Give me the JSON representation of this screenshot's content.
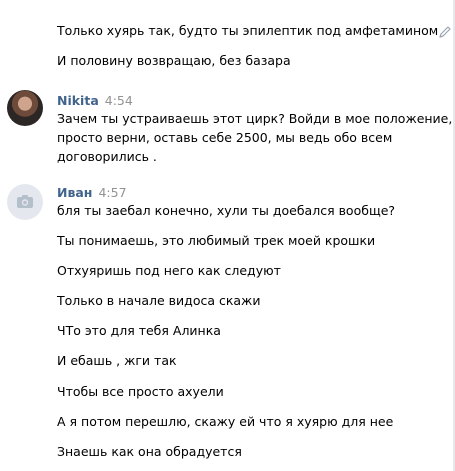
{
  "messages": {
    "first_group": [
      "Только хуярь так, будто ты эпилептик под амфетамином",
      "И половину возвращаю, без базара"
    ],
    "nikita": {
      "author": "Nikita",
      "time": "4:54",
      "lines": [
        "Зачем ты устраиваешь этот цирк? Войди в мое положение,",
        "просто верни, оставь себе 2500, мы ведь обо всем",
        "договорились ."
      ]
    },
    "ivan": {
      "author": "Иван",
      "time": "4:57",
      "lines": [
        "бля ты заебал конечно, хули ты доебался вообще?",
        "Ты понимаешь, это любимый трек моей крошки",
        "Отхуяришь под него как следуют",
        "Только в начале видоса скажи",
        "ЧТо это для тебя Алинка",
        "И ебашь , жги так",
        "Чтобы все просто ахуели",
        "А я потом перешлю, скажу ей что я хуярю для нее",
        "Знаешь как она обрадуется"
      ]
    }
  },
  "icons": {
    "edit": "pencil-icon",
    "avatar_default": "camera-icon"
  },
  "colors": {
    "author_name": "#42648b",
    "timestamp": "#939393",
    "text": "#000000",
    "avatar_placeholder": "#e4e8ee"
  }
}
